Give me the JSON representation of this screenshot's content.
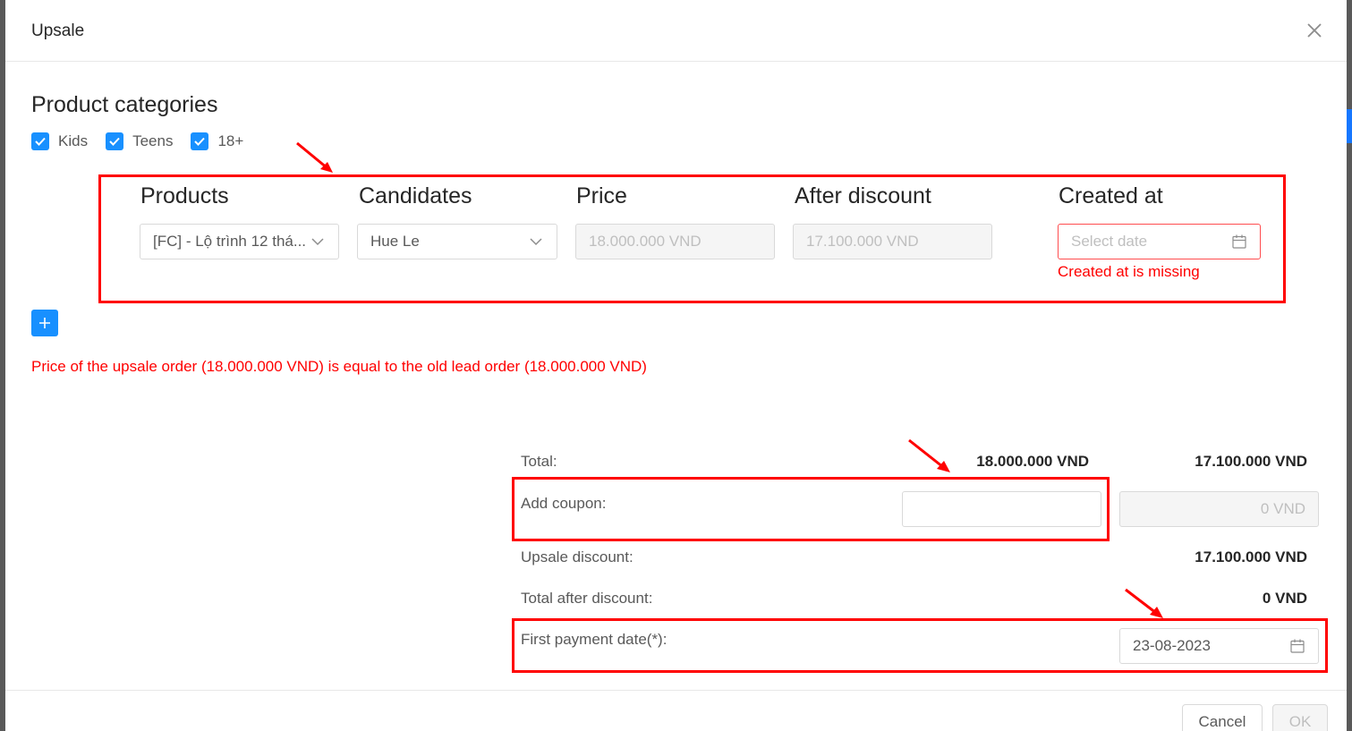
{
  "modal": {
    "title": "Upsale"
  },
  "categories": {
    "title": "Product categories",
    "items": [
      {
        "label": "Kids",
        "checked": true
      },
      {
        "label": "Teens",
        "checked": true
      },
      {
        "label": "18+",
        "checked": true
      }
    ]
  },
  "table": {
    "headers": [
      "Products",
      "Candidates",
      "Price",
      "After discount",
      "Created at"
    ],
    "row": {
      "product": "[FC] - Lộ trình 12 thá...",
      "candidate": "Hue Le",
      "price": "18.000.000 VND",
      "after_discount": "17.100.000 VND",
      "created_at_placeholder": "Select date",
      "created_at_error": "Created at is missing"
    }
  },
  "price_warning": "Price of the upsale order (18.000.000 VND) is equal to the old lead order (18.000.000 VND)",
  "summary": {
    "total_label": "Total:",
    "total_price": "18.000.000 VND",
    "total_after": "17.100.000 VND",
    "coupon_label": "Add coupon:",
    "coupon_value": "",
    "coupon_discount": "0 VND",
    "upsale_discount_label": "Upsale discount:",
    "upsale_discount": "17.100.000 VND",
    "total_after_discount_label": "Total after discount:",
    "total_after_discount": "0 VND",
    "first_payment_label": "First payment date(*):",
    "first_payment_date": "23-08-2023"
  },
  "footer": {
    "cancel_label": "Cancel",
    "ok_label": "OK"
  },
  "colors": {
    "primary": "#1890ff",
    "error": "#ff0000",
    "annotation": "#ff0000"
  },
  "icons": [
    "close-icon",
    "check-icon",
    "chevron-down-icon",
    "calendar-icon",
    "plus-icon",
    "arrow-annotation-icon"
  ]
}
